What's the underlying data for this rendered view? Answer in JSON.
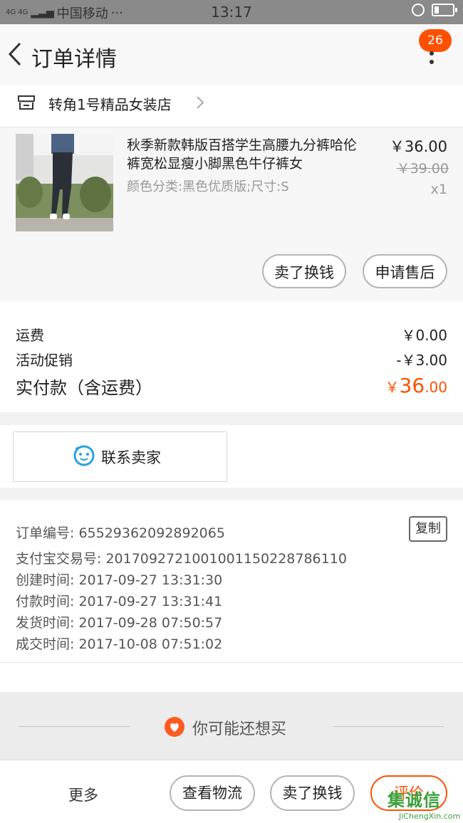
{
  "status_bar": {
    "network": "4G 4G",
    "carrier": "中国移动",
    "dots": "···",
    "time": "13:17"
  },
  "nav": {
    "title": "订单详情",
    "badge_count": "26"
  },
  "shop": {
    "name": "转角1号精品女装店"
  },
  "product": {
    "title": "秋季新款韩版百搭学生高腰九分裤哈伦裤宽松显瘦小脚黑色牛仔裤女",
    "sku": "颜色分类:黑色优质版;尺寸:S",
    "price": "￥36.00",
    "original_price": "￥39.00",
    "quantity": "x1",
    "actions": {
      "sell": "卖了换钱",
      "after_sale": "申请售后"
    }
  },
  "costs": {
    "shipping_label": "运费",
    "shipping_value": "￥0.00",
    "promo_label": "活动促销",
    "promo_value": "-￥3.00",
    "total_label": "实付款（含运费）",
    "total_currency": "￥",
    "total_int": "36",
    "total_dec": ".00"
  },
  "contact": {
    "label": "联系卖家"
  },
  "order_info": {
    "order_no": "订单编号: 65529362092892065",
    "alipay_no": "支付宝交易号: 2017092721001001150228786110",
    "created": "创建时间: 2017-09-27 13:31:30",
    "paid": "付款时间: 2017-09-27 13:31:41",
    "shipped": "发货时间: 2017-09-28 07:50:57",
    "completed": "成交时间: 2017-10-08 07:51:02",
    "copy_label": "复制"
  },
  "recommend": {
    "label": "你可能还想买"
  },
  "bottom_bar": {
    "more": "更多",
    "logistics": "查看物流",
    "sell": "卖了换钱",
    "rate": "评价"
  },
  "watermark": {
    "main": "集诚信",
    "sub": "JiChengXin.com"
  },
  "colors": {
    "accent": "#ff5000",
    "contact_icon": "#29a3e0",
    "watermark": "#3aa13a"
  }
}
